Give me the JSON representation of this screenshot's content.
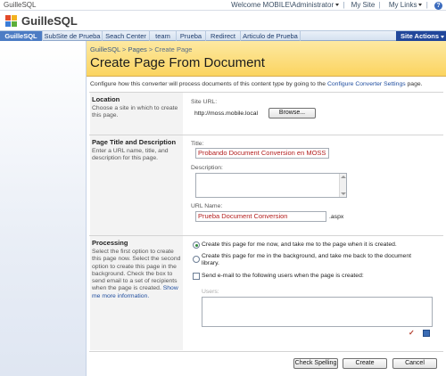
{
  "topbar": {
    "site_name": "GuilleSQL",
    "welcome": "Welcome MOBILE\\Administrator",
    "my_site": "My Site",
    "my_links": "My Links",
    "help": "?"
  },
  "header": {
    "title": "GuilleSQL"
  },
  "tabs": [
    "GuilleSQL",
    "SubSite de Prueba",
    "Seach Center",
    "team",
    "Prueba",
    "Redirect",
    "Articulo de Prueba"
  ],
  "site_actions": "Site Actions",
  "breadcrumb": {
    "root": "GuilleSQL",
    "pages": "Pages",
    "current": "Create Page",
    "sep": ">"
  },
  "page_title": "Create Page From Document",
  "description": {
    "text": "Configure how this converter will process documents of this content type by going to the",
    "link": "Configure Converter Settings",
    "suffix": "page."
  },
  "location": {
    "heading": "Location",
    "text": "Choose a site in which to create this page.",
    "site_url_label": "Site URL:",
    "site_url": "http://moss.mobile.local",
    "browse": "Browse..."
  },
  "page_title_section": {
    "heading": "Page Title and Description",
    "text": "Enter a URL name, title, and description for this page.",
    "title_label": "Title:",
    "title_value": "Probando Document Conversion en MOSS",
    "description_label": "Description:",
    "url_name_label": "URL Name:",
    "url_name_value": "Prueba Document Conversion",
    "url_suffix": ".aspx"
  },
  "processing": {
    "heading": "Processing",
    "text": "Select the first option to create this page now. Select the second option to create this page in the background. Check the box to send email to a set of recipients when the page is created.",
    "show_more": "Show me more information.",
    "option1": "Create this page for me now, and take me to the page when it is created.",
    "option2": "Create this page for me in the background, and take me back to the document library.",
    "send_email": "Send e-mail to the following users when the page is created:",
    "users_label": "Users:"
  },
  "buttons": {
    "check_spelling": "Check Spelling",
    "create": "Create",
    "cancel": "Cancel"
  },
  "colors": {
    "tab_active": "#4c7cc4",
    "site_actions": "#21479a",
    "title_area": "#fbd460"
  }
}
